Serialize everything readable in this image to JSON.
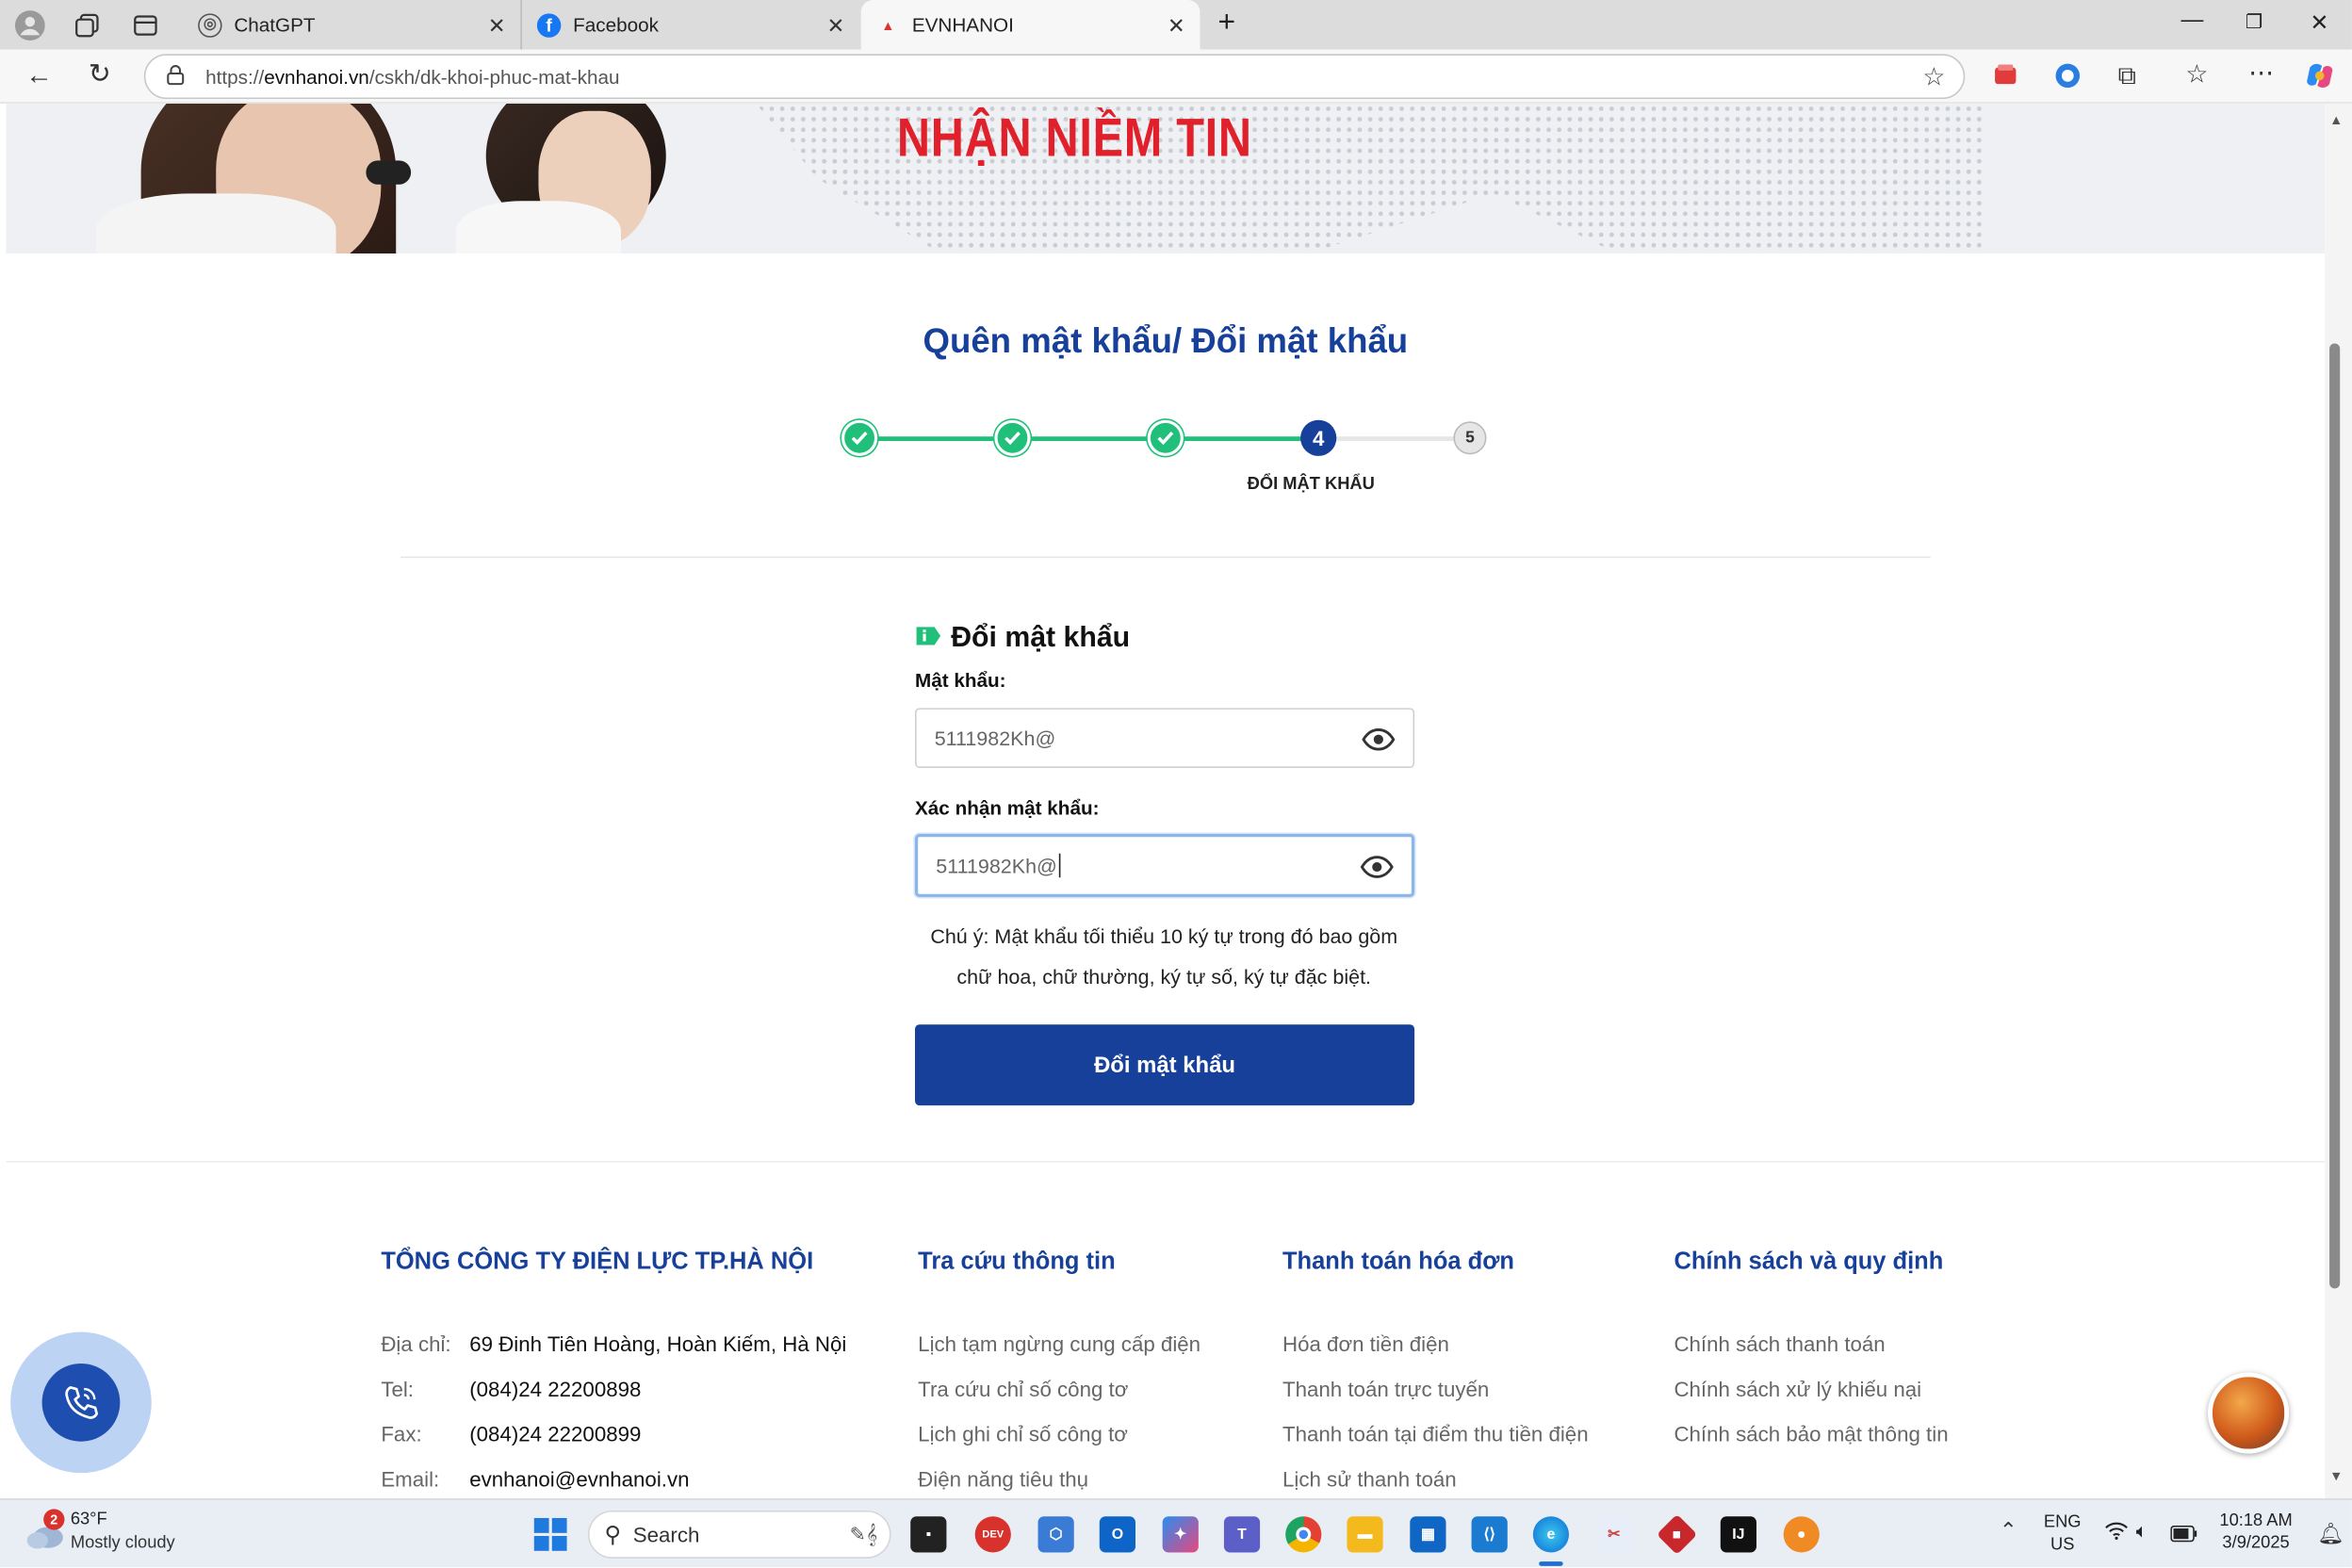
{
  "browser": {
    "tabs": [
      {
        "title": "ChatGPT",
        "icon": "chatgpt-icon"
      },
      {
        "title": "Facebook",
        "icon": "facebook-icon"
      },
      {
        "title": "EVNHANOI",
        "icon": "evn-icon",
        "active": true
      }
    ],
    "url_prefix": "https://",
    "url_domain": "evnhanoi.vn",
    "url_path": "/cskh/dk-khoi-phuc-mat-khau"
  },
  "banner": {
    "title": "NHẬN NIỀM TIN"
  },
  "form": {
    "title": "Quên mật khẩu/ Đổi mật khẩu",
    "steps": [
      {
        "label": "",
        "state": "done"
      },
      {
        "label": "",
        "state": "done"
      },
      {
        "label": "",
        "state": "done"
      },
      {
        "label": "4",
        "state": "current"
      },
      {
        "label": "5",
        "state": "pending"
      }
    ],
    "current_step_label": "ĐỔI MẬT KHẨU",
    "section_title": "Đổi mật khẩu",
    "password_label": "Mật khẩu:",
    "password_value": "5111982Kh@",
    "confirm_label": "Xác nhận mật khẩu:",
    "confirm_value": "5111982Kh@",
    "note_line1": "Chú ý: Mật khẩu tối thiểu 10 ký tự trong đó bao gồm",
    "note_line2": "chữ hoa, chữ thường, ký tự số, ký tự đặc biệt.",
    "submit_label": "Đổi mật khẩu"
  },
  "footer": {
    "company": {
      "title": "TỔNG CÔNG TY ĐIỆN LỰC TP.HÀ NỘI",
      "rows": [
        {
          "label": "Địa chỉ:",
          "value": "69 Đinh Tiên Hoàng, Hoàn Kiếm, Hà Nội"
        },
        {
          "label": "Tel:",
          "value": "(084)24 22200898"
        },
        {
          "label": "Fax:",
          "value": "(084)24 22200899"
        },
        {
          "label": "Email:",
          "value": "evnhanoi@evnhanoi.vn"
        }
      ]
    },
    "lookup": {
      "title": "Tra cứu thông tin",
      "items": [
        "Lịch tạm ngừng cung cấp điện",
        "Tra cứu chỉ số công tơ",
        "Lịch ghi chỉ số công tơ",
        "Điện năng tiêu thụ"
      ]
    },
    "payment": {
      "title": "Thanh toán hóa đơn",
      "items": [
        "Hóa đơn tiền điện",
        "Thanh toán trực tuyến",
        "Thanh toán tại điểm thu tiền điện",
        "Lịch sử thanh toán"
      ]
    },
    "policy": {
      "title": "Chính sách và quy định",
      "items": [
        "Chính sách thanh toán",
        "Chính sách xử lý khiếu nại",
        "Chính sách bảo mật thông tin"
      ]
    }
  },
  "taskbar": {
    "weather_temp": "63°F",
    "weather_desc": "Mostly cloudy",
    "weather_badge": "2",
    "search_placeholder": "Search",
    "lang_line1": "ENG",
    "lang_line2": "US",
    "time": "10:18 AM",
    "date": "3/9/2025"
  },
  "colors": {
    "brand_blue": "#17409a",
    "step_green": "#21c07a",
    "banner_red": "#e0202a"
  }
}
